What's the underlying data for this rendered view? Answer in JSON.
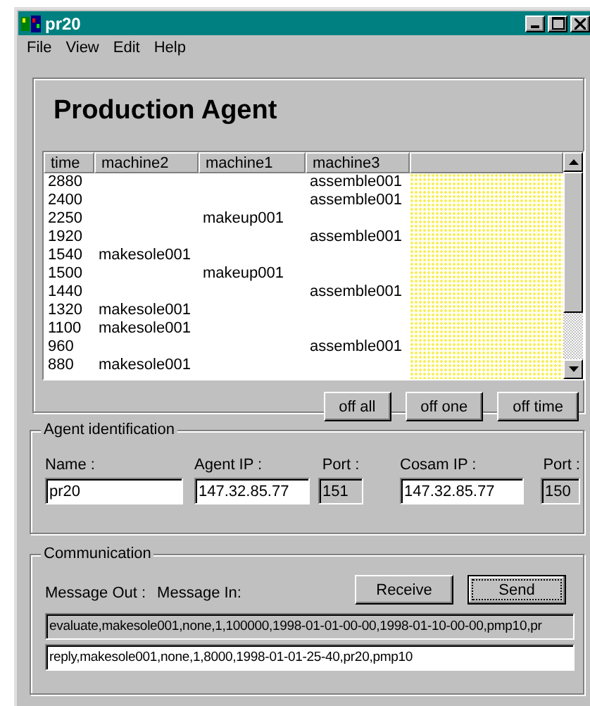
{
  "window": {
    "title": "pr20"
  },
  "menu": [
    "File",
    "View",
    "Edit",
    "Help"
  ],
  "heading": "Production Agent",
  "table": {
    "columns": [
      "time",
      "machine2",
      "machine1",
      "machine3"
    ],
    "rows": [
      [
        "2880",
        "",
        "",
        "assemble001"
      ],
      [
        "2400",
        "",
        "",
        "assemble001"
      ],
      [
        "2250",
        "",
        "makeup001",
        ""
      ],
      [
        "1920",
        "",
        "",
        "assemble001"
      ],
      [
        "1540",
        "makesole001",
        "",
        ""
      ],
      [
        "1500",
        "",
        "makeup001",
        ""
      ],
      [
        "1440",
        "",
        "",
        "assemble001"
      ],
      [
        "1320",
        "makesole001",
        "",
        ""
      ],
      [
        "1100",
        "makesole001",
        "",
        ""
      ],
      [
        "960",
        "",
        "",
        "assemble001"
      ],
      [
        "880",
        "makesole001",
        "",
        ""
      ]
    ]
  },
  "table_buttons": [
    "off all",
    "off one",
    "off time"
  ],
  "agent_identification": {
    "title": "Agent identification",
    "fields": [
      {
        "label": "Name :",
        "value": "pr20",
        "kind": "edit"
      },
      {
        "label": "Agent IP :",
        "value": "147.32.85.77",
        "kind": "edit"
      },
      {
        "label": "Port :",
        "value": "151",
        "kind": "readonly"
      },
      {
        "label": "Cosam IP :",
        "value": "147.32.85.77",
        "kind": "edit"
      },
      {
        "label": "Port :",
        "value": "150",
        "kind": "readonly"
      }
    ]
  },
  "communication": {
    "title": "Communication",
    "labels": [
      "Message Out :",
      "Message In:"
    ],
    "buttons": [
      {
        "label": "Receive",
        "focused": false
      },
      {
        "label": "Send",
        "focused": true
      }
    ],
    "message_out": "evaluate,makesole001,none,1,100000,1998-01-01-00-00,1998-01-10-00-00,pmp10,pr",
    "message_in": "reply,makesole001,none,1,8000,1998-01-01-25-40,pr20,pmp10"
  }
}
